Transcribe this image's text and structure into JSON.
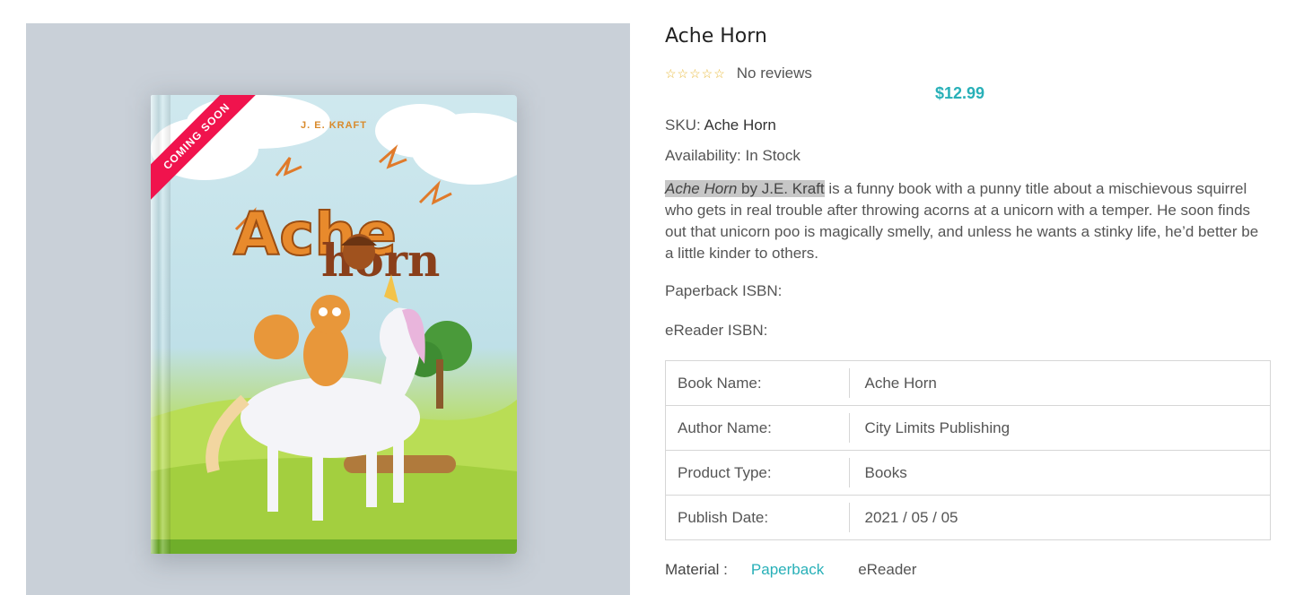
{
  "product": {
    "title": "Ache Horn",
    "rating_stars": "☆☆☆☆☆",
    "reviews_text": "No reviews",
    "price": "$12.99",
    "sku_label": "SKU:",
    "sku_value": "Ache Horn",
    "availability_label": "Availability:",
    "availability_value": "In Stock",
    "description": {
      "highlight_title": "Ache Horn",
      "highlight_by": " by J.E. Kraft",
      "rest": " is a funny book with a punny title about a mischievous squirrel who gets in real trouble after throwing acorns at a unicorn with a temper. He soon finds out that unicorn poo is magically smelly, and unless he wants a stinky life, he’d better be a little kinder to others."
    },
    "paperback_isbn_label": "Paperback ISBN:",
    "ereader_isbn_label": "eReader ISBN:"
  },
  "specs": [
    {
      "key": "Book Name:",
      "value": "Ache Horn"
    },
    {
      "key": "Author Name:",
      "value": "City Limits Publishing"
    },
    {
      "key": "Product Type:",
      "value": "Books"
    },
    {
      "key": "Publish Date:",
      "value": "2021 / 05 / 05"
    }
  ],
  "material": {
    "label": "Material :",
    "options": [
      "Paperback",
      "eReader"
    ],
    "selected": "Paperback"
  },
  "cover": {
    "ribbon": "COMING SOON",
    "author": "J. E. KRAFT",
    "title_top": "Ache",
    "title_bottom": "horn"
  },
  "colors": {
    "accent": "#28b0b8",
    "ribbon": "#f0134d",
    "star": "#e8b93a"
  }
}
